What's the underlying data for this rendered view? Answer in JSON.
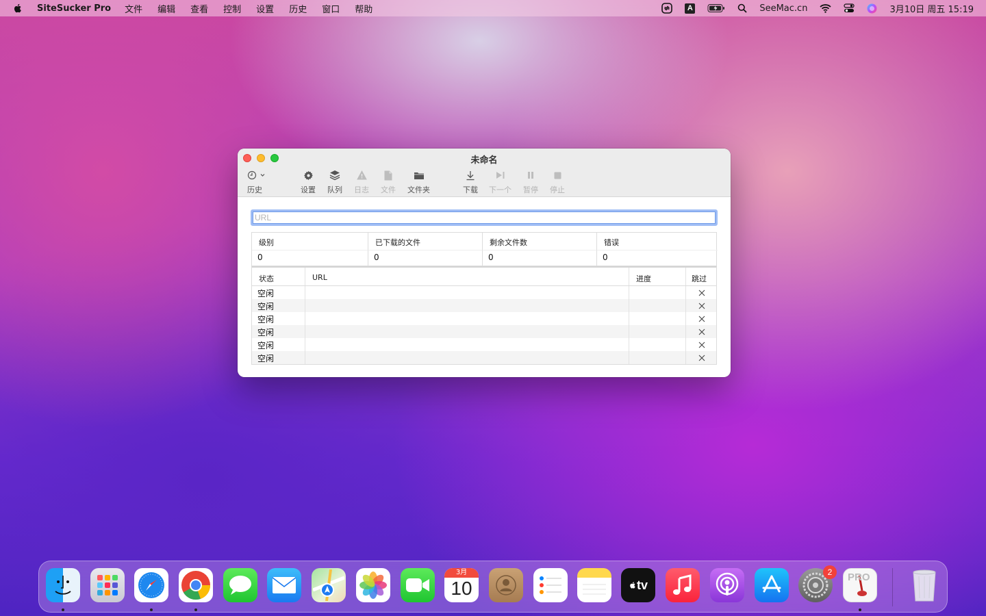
{
  "menubar": {
    "app_name": "SiteSucker Pro",
    "menus": [
      "文件",
      "编辑",
      "查看",
      "控制",
      "设置",
      "历史",
      "窗口",
      "帮助"
    ],
    "right": {
      "site": "SeeMac.cn",
      "input_method": "A",
      "datetime": "3月10日 周五 15:19"
    }
  },
  "window": {
    "title": "未命名",
    "toolbar": {
      "history": "历史",
      "settings": "设置",
      "queue": "队列",
      "log": "日志",
      "file": "文件",
      "folder": "文件夹",
      "download": "下载",
      "next": "下一个",
      "pause": "暂停",
      "stop": "停止"
    },
    "url_placeholder": "URL",
    "url_value": "",
    "stats": {
      "headers": [
        "级别",
        "已下载的文件",
        "剩余文件数",
        "错误"
      ],
      "values": [
        "0",
        "0",
        "0",
        "0"
      ]
    },
    "table": {
      "headers": [
        "状态",
        "URL",
        "进度",
        "跳过"
      ],
      "rows": [
        {
          "status": "空闲",
          "url": "",
          "progress": ""
        },
        {
          "status": "空闲",
          "url": "",
          "progress": ""
        },
        {
          "status": "空闲",
          "url": "",
          "progress": ""
        },
        {
          "status": "空闲",
          "url": "",
          "progress": ""
        },
        {
          "status": "空闲",
          "url": "",
          "progress": ""
        },
        {
          "status": "空闲",
          "url": "",
          "progress": ""
        }
      ]
    }
  },
  "dock": {
    "calendar_month": "3月",
    "calendar_day": "10",
    "settings_badge": "2",
    "tv_label": "tv",
    "pro_label": "PRO"
  }
}
